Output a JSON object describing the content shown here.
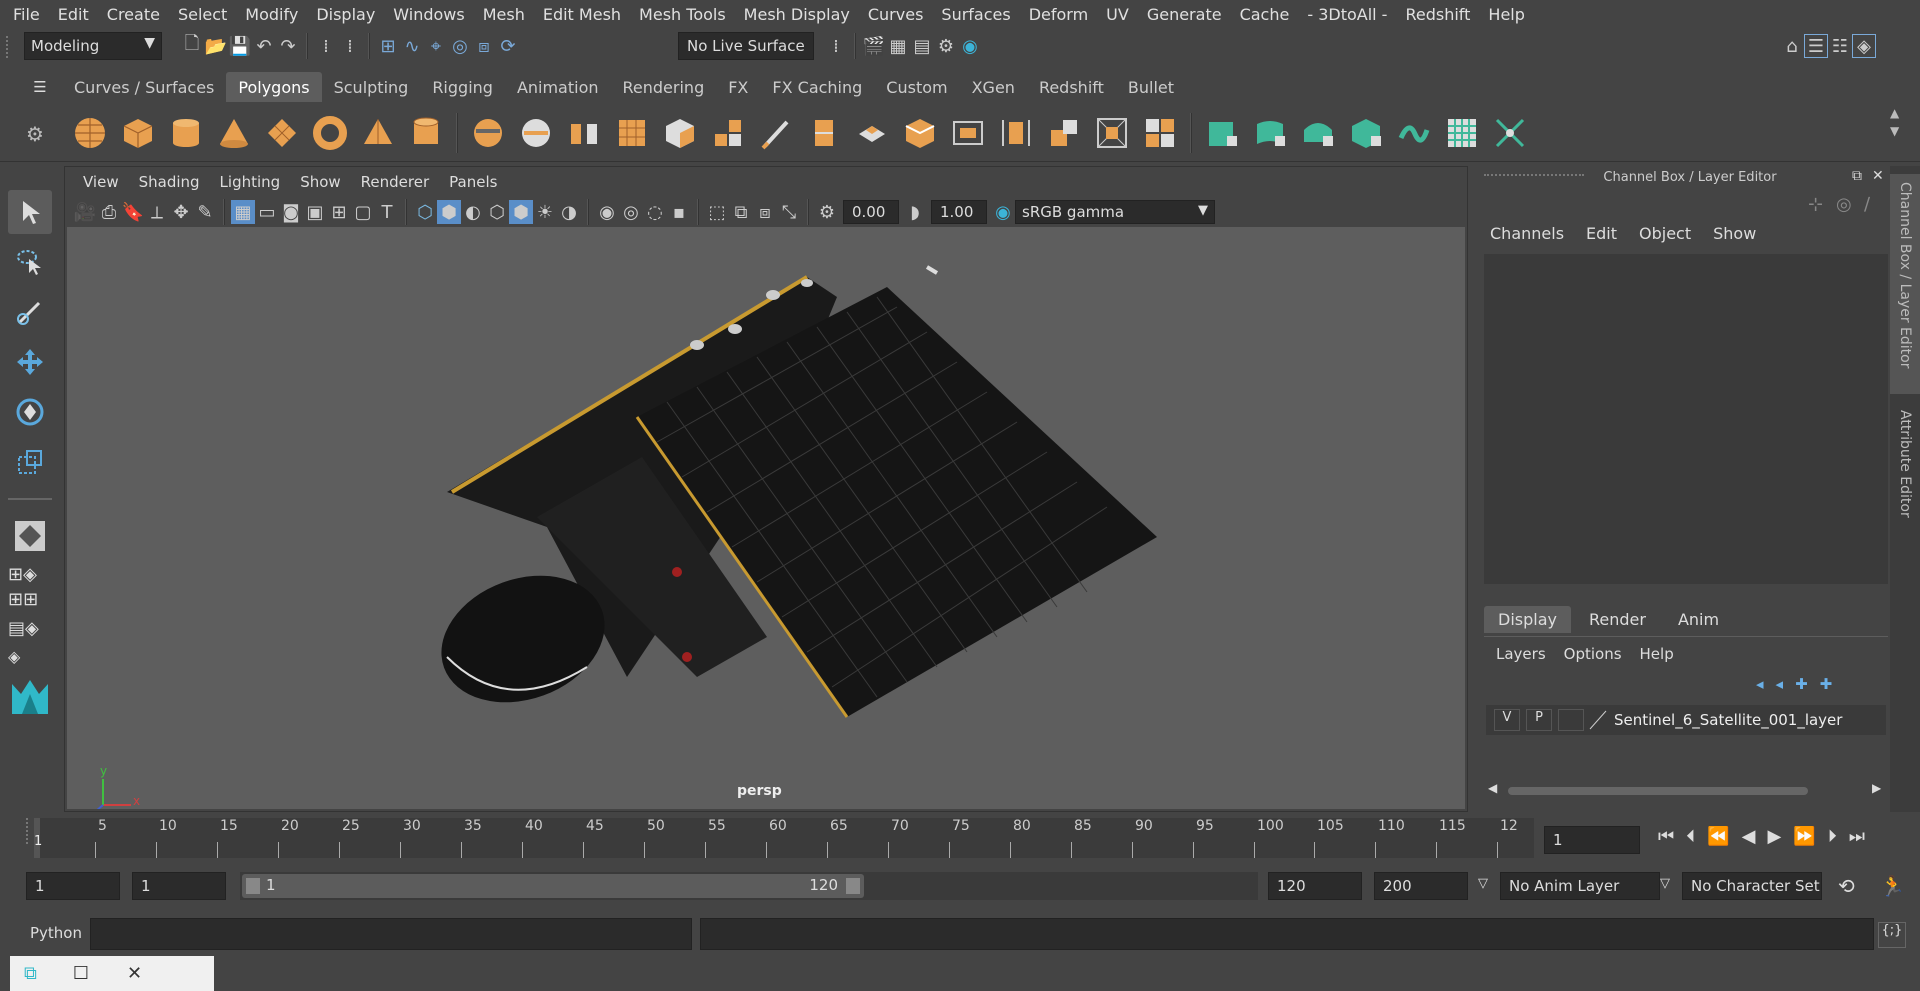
{
  "menubar": {
    "items": [
      "File",
      "Edit",
      "Create",
      "Select",
      "Modify",
      "Display",
      "Windows",
      "Mesh",
      "Edit Mesh",
      "Mesh Tools",
      "Mesh Display",
      "Curves",
      "Surfaces",
      "Deform",
      "UV",
      "Generate",
      "Cache",
      "- 3DtoAll -",
      "Redshift",
      "Help"
    ]
  },
  "statusline": {
    "mode": "Modeling",
    "live_surface": "No Live Surface"
  },
  "shelf": {
    "tabs": [
      "Curves / Surfaces",
      "Polygons",
      "Sculpting",
      "Rigging",
      "Animation",
      "Rendering",
      "FX",
      "FX Caching",
      "Custom",
      "XGen",
      "Redshift",
      "Bullet"
    ],
    "active_tab": "Polygons"
  },
  "viewport": {
    "menu": [
      "View",
      "Shading",
      "Lighting",
      "Show",
      "Renderer",
      "Panels"
    ],
    "exposure": "0.00",
    "gamma": "1.00",
    "color_space": "sRGB gamma",
    "camera_label": "persp",
    "axis_x": "x",
    "axis_y": "y",
    "axis_z": "z"
  },
  "channelbox": {
    "title": "Channel Box / Layer Editor",
    "menu": [
      "Channels",
      "Edit",
      "Object",
      "Show"
    ]
  },
  "layereditor": {
    "tabs": [
      "Display",
      "Render",
      "Anim"
    ],
    "active_tab": "Display",
    "menu": [
      "Layers",
      "Options",
      "Help"
    ],
    "layer": {
      "v": "V",
      "p": "P",
      "name": "Sentinel_6_Satellite_001_layer"
    }
  },
  "sidetabs": {
    "channel": "Channel Box / Layer Editor",
    "attribute": "Attribute Editor"
  },
  "timeslider": {
    "ticks": [
      "5",
      "10",
      "15",
      "20",
      "25",
      "30",
      "35",
      "40",
      "45",
      "50",
      "55",
      "60",
      "65",
      "70",
      "75",
      "80",
      "85",
      "90",
      "95",
      "100",
      "105",
      "110",
      "115",
      "12"
    ],
    "start_marker": "1",
    "current_frame": "1"
  },
  "rangeslider": {
    "start": "1",
    "playback_start": "1",
    "range_start": "1",
    "range_end_label": "120",
    "playback_end": "120",
    "end": "200",
    "anim_layer": "No Anim Layer",
    "char_set": "No Character Set"
  },
  "cmdline": {
    "language": "Python"
  },
  "colors": {
    "accent_orange": "#e8a050",
    "accent_teal": "#40b89a",
    "active_blue": "#5a8ec8"
  }
}
